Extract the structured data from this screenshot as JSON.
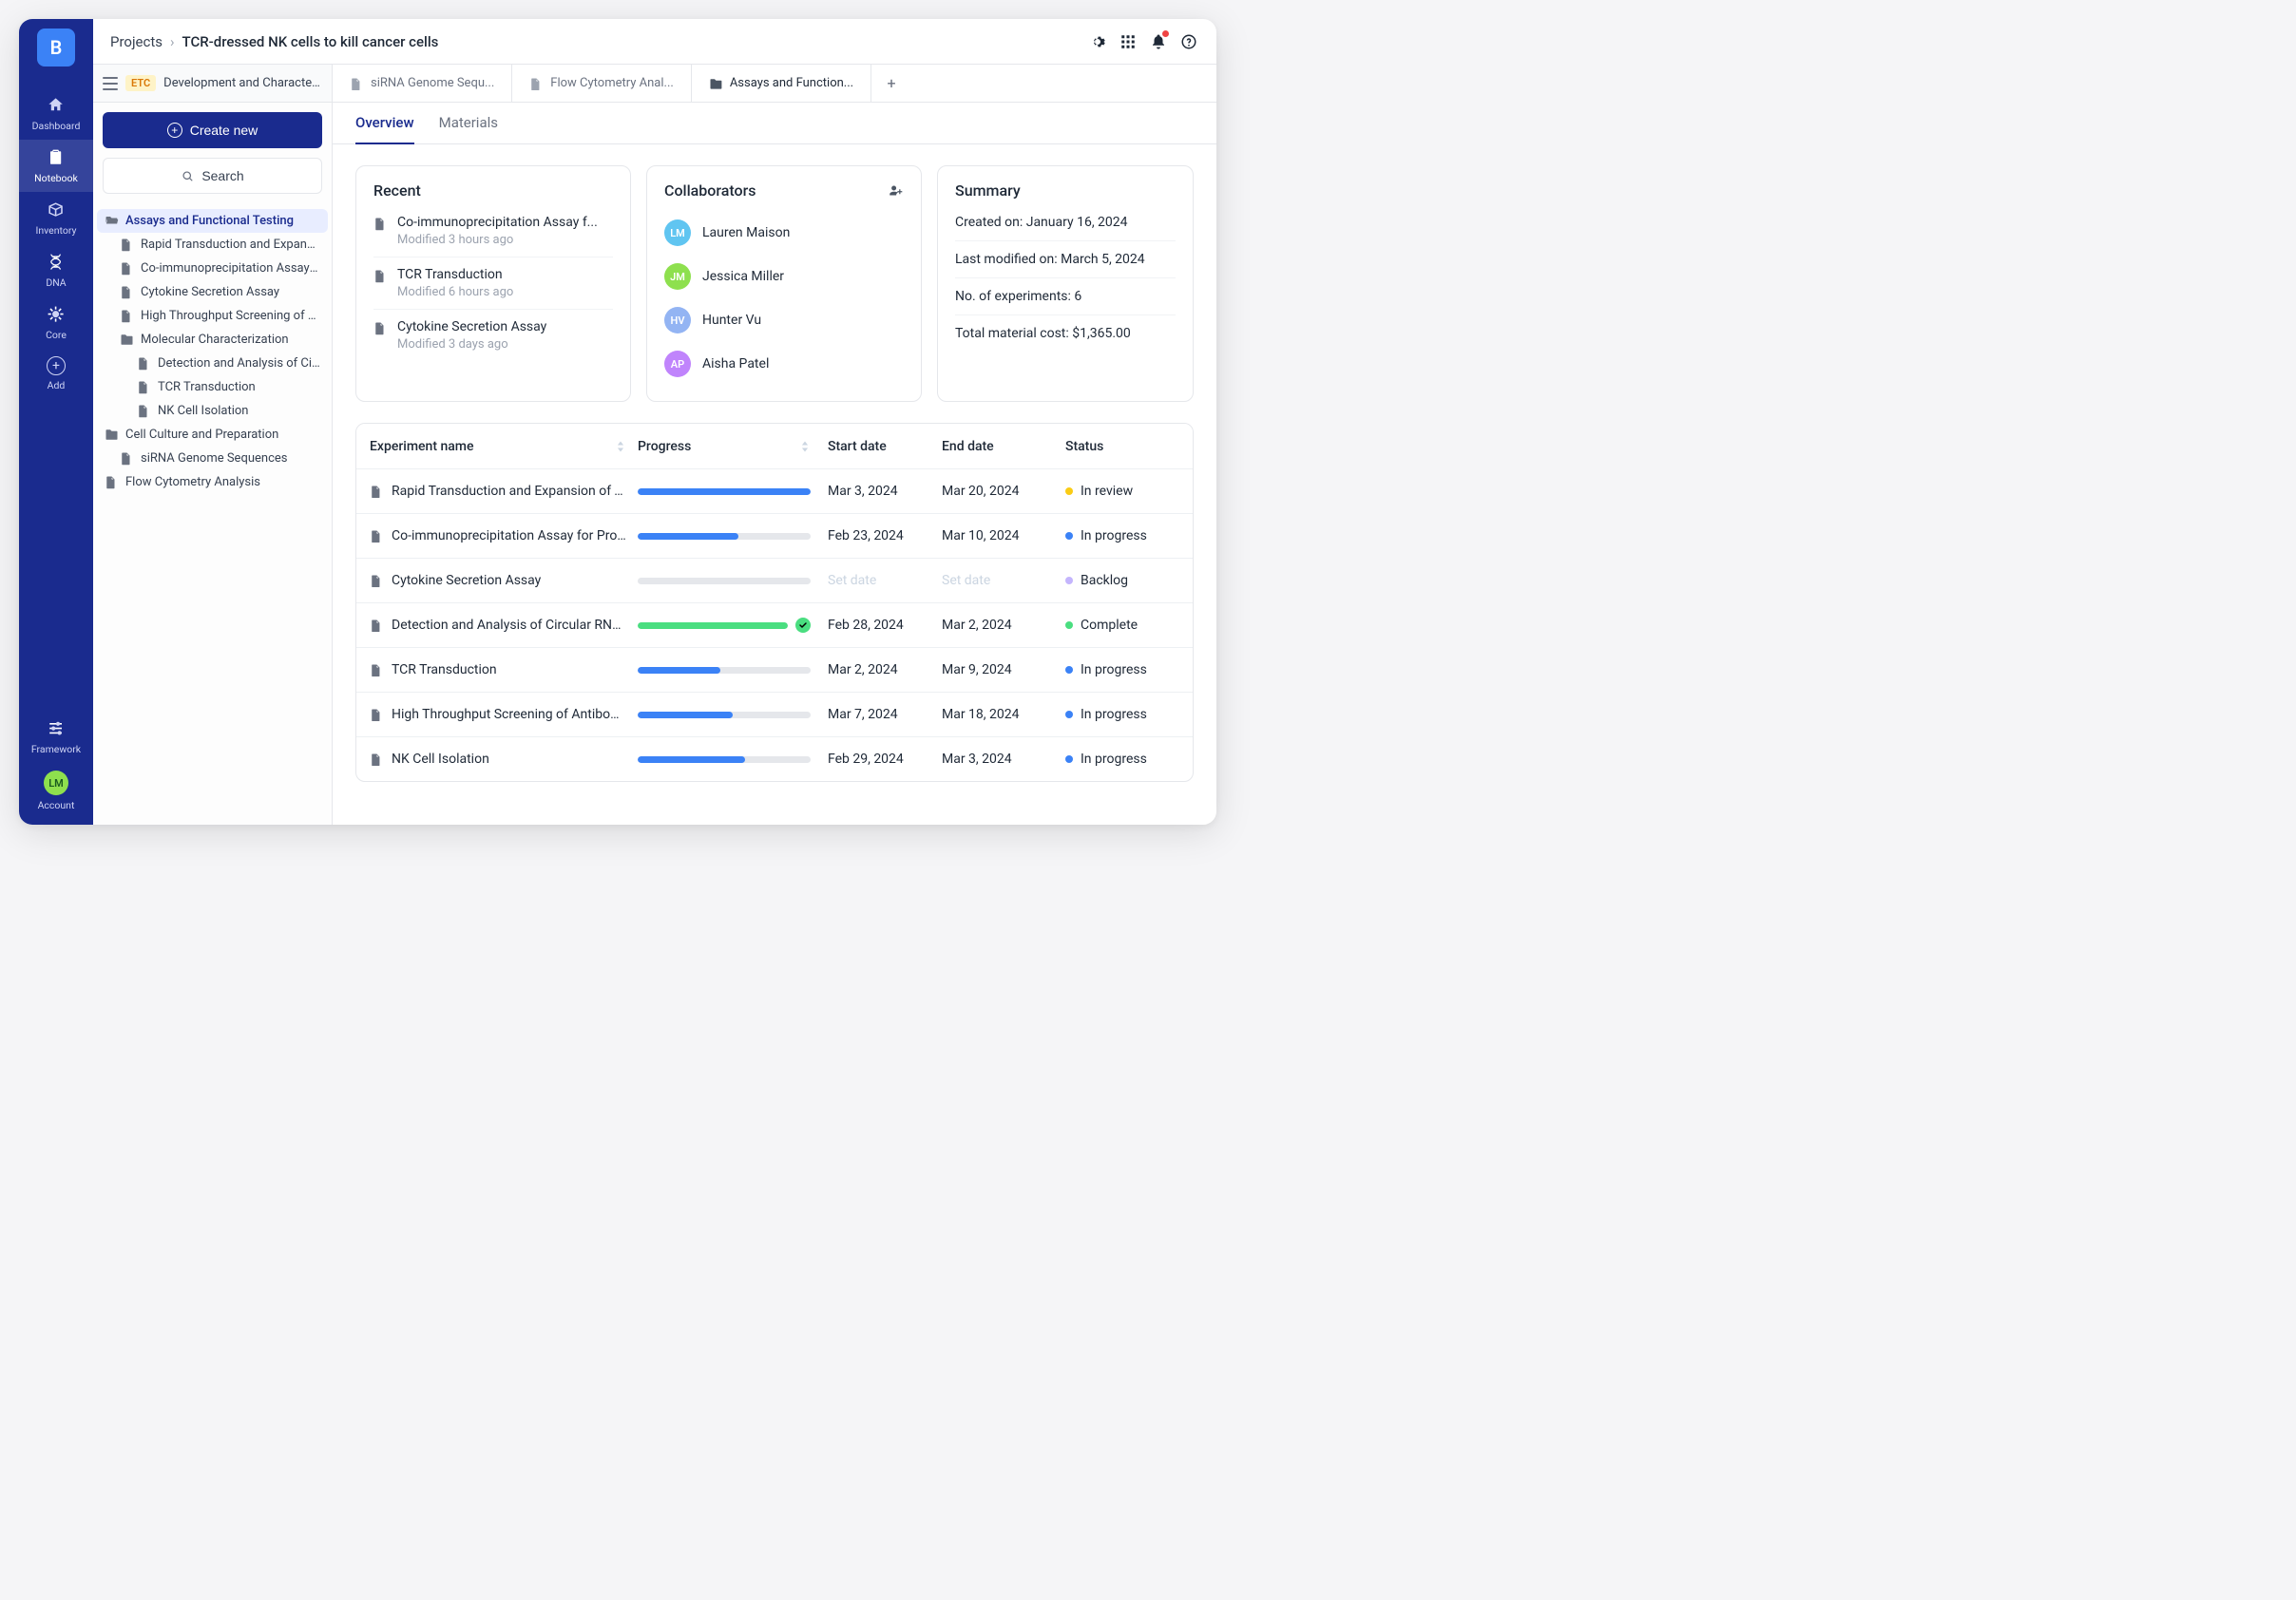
{
  "rail": {
    "logo": "B",
    "items": [
      {
        "label": "Dashboard"
      },
      {
        "label": "Notebook"
      },
      {
        "label": "Inventory"
      },
      {
        "label": "DNA"
      },
      {
        "label": "Core"
      },
      {
        "label": "Add"
      }
    ],
    "bottom": [
      {
        "label": "Framework"
      },
      {
        "label": "Account"
      }
    ],
    "account_avatar": "LM"
  },
  "topbar": {
    "breadcrumb_root": "Projects",
    "breadcrumb_current": "TCR-dressed NK cells to kill cancer cells"
  },
  "sidebar": {
    "badge": "ETC",
    "title": "Development and Characteriza...",
    "create_label": "Create new",
    "search_label": "Search"
  },
  "tree": [
    {
      "type": "folder",
      "depth": 0,
      "label": "Assays and Functional Testing",
      "active": true
    },
    {
      "type": "file",
      "depth": 1,
      "label": "Rapid Transduction and Expansio..."
    },
    {
      "type": "file",
      "depth": 1,
      "label": "Co-immunoprecipitation Assay fo..."
    },
    {
      "type": "file",
      "depth": 1,
      "label": "Cytokine Secretion Assay"
    },
    {
      "type": "file",
      "depth": 1,
      "label": "High Throughput Screening of An..."
    },
    {
      "type": "folder",
      "depth": 1,
      "label": "Molecular Characterization"
    },
    {
      "type": "file",
      "depth": 2,
      "label": "Detection and Analysis of Cir..."
    },
    {
      "type": "file",
      "depth": 2,
      "label": "TCR Transduction"
    },
    {
      "type": "file",
      "depth": 2,
      "label": "NK Cell Isolation"
    },
    {
      "type": "folder",
      "depth": 0,
      "label": "Cell Culture and Preparation"
    },
    {
      "type": "file",
      "depth": 1,
      "label": "siRNA Genome Sequences"
    },
    {
      "type": "file",
      "depth": 0,
      "label": "Flow Cytometry Analysis"
    }
  ],
  "tabs": [
    {
      "icon": "file",
      "label": "siRNA Genome Sequ..."
    },
    {
      "icon": "file",
      "label": "Flow Cytometry Anal..."
    },
    {
      "icon": "folder",
      "label": "Assays and Function...",
      "active": true
    }
  ],
  "subtabs": {
    "overview": "Overview",
    "materials": "Materials"
  },
  "recent": {
    "title": "Recent",
    "items": [
      {
        "title": "Co-immunoprecipitation Assay f...",
        "meta": "Modified 3 hours ago"
      },
      {
        "title": "TCR Transduction",
        "meta": "Modified 6 hours ago"
      },
      {
        "title": "Cytokine Secretion Assay",
        "meta": "Modified 3 days ago"
      }
    ]
  },
  "collaborators": {
    "title": "Collaborators",
    "items": [
      {
        "initials": "LM",
        "name": "Lauren Maison",
        "color": "#60c5f1"
      },
      {
        "initials": "JM",
        "name": "Jessica Miller",
        "color": "#8ee04e"
      },
      {
        "initials": "HV",
        "name": "Hunter Vu",
        "color": "#93b4f3"
      },
      {
        "initials": "AP",
        "name": "Aisha Patel",
        "color": "#c084fc"
      }
    ]
  },
  "summary": {
    "title": "Summary",
    "rows": [
      "Created on: January 16, 2024",
      "Last modified on: March 5, 2024",
      "No. of experiments: 6",
      "Total material cost: $1,365.00"
    ]
  },
  "table": {
    "columns": {
      "experiment": "Experiment name",
      "progress": "Progress",
      "start": "Start date",
      "end": "End date",
      "status": "Status"
    },
    "placeholder_date": "Set date",
    "rows": [
      {
        "name": "Rapid Transduction and Expansion of Tran...",
        "progress": 100,
        "color": "blue",
        "check": false,
        "start": "Mar 3, 2024",
        "end": "Mar 20, 2024",
        "status": "In review",
        "status_color": "#facc15"
      },
      {
        "name": "Co-immunoprecipitation Assay for Protei...",
        "progress": 58,
        "color": "blue",
        "check": false,
        "start": "Feb 23, 2024",
        "end": "Mar 10, 2024",
        "status": "In progress",
        "status_color": "#3b82f6"
      },
      {
        "name": "Cytokine Secretion Assay",
        "progress": 0,
        "color": "blue",
        "check": false,
        "start": "",
        "end": "",
        "status": "Backlog",
        "status_color": "#c4b5fd"
      },
      {
        "name": "Detection and Analysis of Circular RNAs...",
        "progress": 100,
        "color": "green",
        "check": true,
        "start": "Feb 28, 2024",
        "end": "Mar 2, 2024",
        "status": "Complete",
        "status_color": "#4ade80"
      },
      {
        "name": "TCR Transduction",
        "progress": 48,
        "color": "blue",
        "check": false,
        "start": "Mar 2, 2024",
        "end": "Mar 9, 2024",
        "status": "In progress",
        "status_color": "#3b82f6"
      },
      {
        "name": "High Throughput Screening of Antibody P...",
        "progress": 55,
        "color": "blue",
        "check": false,
        "start": "Mar 7, 2024",
        "end": "Mar 18, 2024",
        "status": "In progress",
        "status_color": "#3b82f6"
      },
      {
        "name": "NK Cell Isolation",
        "progress": 62,
        "color": "blue",
        "check": false,
        "start": "Feb 29, 2024",
        "end": "Mar 3, 2024",
        "status": "In progress",
        "status_color": "#3b82f6"
      }
    ]
  }
}
